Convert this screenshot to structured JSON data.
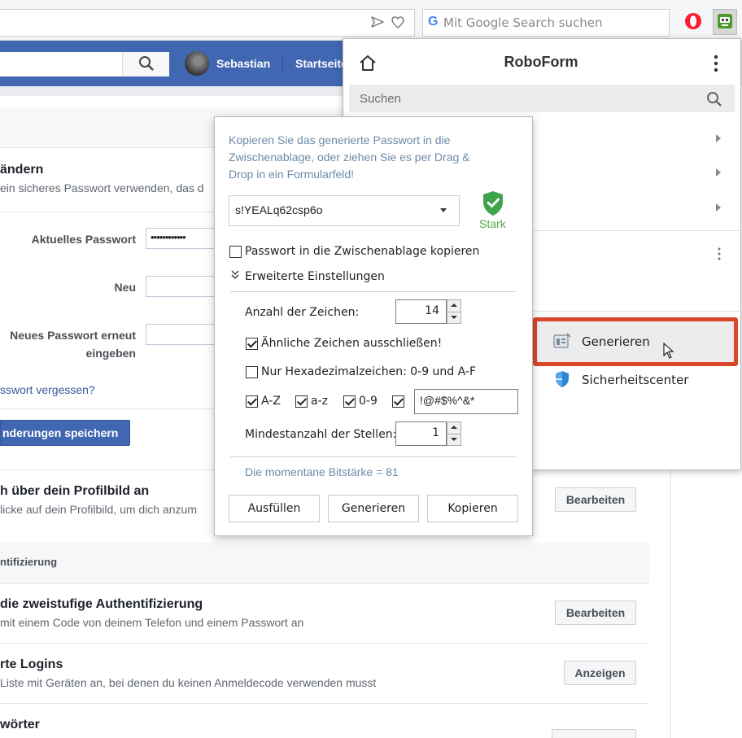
{
  "browser": {
    "search_placeholder": "Mit Google Search suchen",
    "google_letter": "G"
  },
  "facebook": {
    "user_name": "Sebastian",
    "home_link": "Startseite",
    "password": {
      "title": "ändern",
      "desc": "ein sicheres Passwort verwenden, das d",
      "current_label": "Aktuelles Passwort",
      "current_value": "••••••••••••",
      "new_label": "Neu",
      "repeat_label_1": "Neues Passwort erneut",
      "repeat_label_2": "eingeben",
      "forgot_link": "sswort vergessen?",
      "save_button": "nderungen speichern"
    },
    "profile": {
      "title": "h über dein Profilbild an",
      "desc": "licke auf dein Profilbild, um dich anzum",
      "edit_button": "Bearbeiten"
    },
    "auth_head": "ntifizierung",
    "two_factor": {
      "title": "die zweistufige Authentifizierung",
      "desc": "mit einem Code von deinem Telefon und einem Passwort an",
      "edit_button": "Bearbeiten"
    },
    "logins": {
      "title": "rte Logins",
      "desc": "Liste mit Geräten an, bei denen du keinen Anmeldecode verwenden musst",
      "show_button": "Anzeigen"
    },
    "passwords": {
      "title": "wörter"
    }
  },
  "roboform": {
    "title": "RoboForm",
    "search_placeholder": "Suchen",
    "menu": {
      "generate": "Generieren",
      "security_center": "Sicherheitscenter"
    },
    "highlight_color": "#d9472b"
  },
  "generator": {
    "description": "Kopieren Sie das generierte Passwort in die Zwischenablage, oder ziehen Sie es per Drag & Drop in ein Formularfeld!",
    "password": "s!YEALq62csp6o",
    "strength": "Stark",
    "copy_to_clipboard_label": "Passwort in die Zwischenablage kopieren",
    "copy_to_clipboard_checked": false,
    "advanced_label": "Erweiterte Einstellungen",
    "char_count_label": "Anzahl der Zeichen:",
    "char_count": "14",
    "exclude_similar_label": "Ähnliche Zeichen ausschließen!",
    "exclude_similar_checked": true,
    "hex_only_label": "Nur Hexadezimalzeichen: 0-9 und A-F",
    "hex_only_checked": false,
    "upper_label": "A-Z",
    "lower_label": "a-z",
    "digits_label": "0-9",
    "special_chars": "!@#$%^&*",
    "min_digits_label": "Mindestanzahl der Stellen:",
    "min_digits": "1",
    "bit_strength": "Die momentane Bitstärke = 81",
    "buttons": {
      "fill": "Ausfüllen",
      "generate": "Generieren",
      "copy": "Kopieren"
    }
  }
}
